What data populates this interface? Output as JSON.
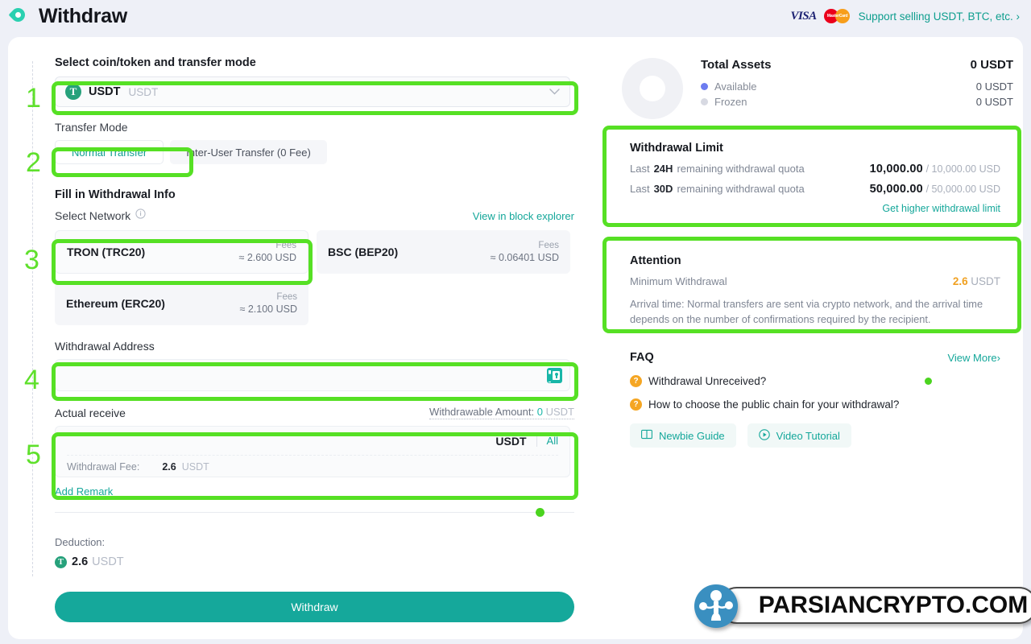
{
  "header": {
    "title": "Withdraw",
    "logo_icon": "app-logo-icon",
    "visa_label": "VISA",
    "mastercard_label": "MasterCard",
    "support_link": "Support selling USDT, BTC, etc.",
    "support_chevron": "›"
  },
  "left": {
    "step1": {
      "number": "1",
      "title": "Select coin/token and transfer mode",
      "coin": {
        "symbol_icon": "T",
        "name": "USDT",
        "sub": "USDT",
        "chevron": "⌄"
      },
      "transfer_mode_label": "Transfer Mode",
      "modes": [
        {
          "label": "Normal Transfer",
          "active": true
        },
        {
          "label": "Inter-User Transfer (0 Fee)",
          "active": false
        }
      ]
    },
    "step2": {
      "number": "2",
      "title": "Fill in Withdrawal Info",
      "select_network_label": "Select Network",
      "info_icon": "info-icon",
      "block_explorer_link": "View in block explorer",
      "networks": [
        {
          "name": "TRON (TRC20)",
          "fees_label": "Fees",
          "fee_value": "≈ 2.600 USD",
          "selected": true
        },
        {
          "name": "BSC (BEP20)",
          "fees_label": "Fees",
          "fee_value": "≈ 0.06401 USD",
          "selected": false
        },
        {
          "name": "Ethereum (ERC20)",
          "fees_label": "Fees",
          "fee_value": "≈ 2.100 USD",
          "selected": false
        }
      ],
      "address_label": "Withdrawal Address",
      "address_value": "",
      "address_placeholder": "",
      "address_book_icon": "address-book-icon",
      "actual_receive_label": "Actual receive",
      "withdrawable_prefix": "Withdrawable Amount:",
      "withdrawable_amount": "0",
      "withdrawable_unit": "USDT",
      "amount_value": "",
      "amount_unit": "USDT",
      "all_label": "All",
      "fee_label": "Withdrawal Fee:",
      "fee_value": "2.6",
      "fee_unit": "USDT",
      "add_remark_label": "Add Remark"
    },
    "deduction_label": "Deduction:",
    "deduction_icon": "T",
    "deduction_value": "2.6",
    "deduction_unit": "USDT",
    "withdraw_button": "Withdraw"
  },
  "right": {
    "assets": {
      "title": "Total Assets",
      "total": "0 USDT",
      "rows": [
        {
          "label": "Available",
          "value": "0 USDT",
          "color": "#6c7cf0"
        },
        {
          "label": "Frozen",
          "value": "0 USDT",
          "color": "#d7d9e2"
        }
      ]
    },
    "limit": {
      "title": "Withdrawal Limit",
      "rows": [
        {
          "prefix": "Last",
          "period": "24H",
          "text": "remaining withdrawal quota",
          "remaining": "10,000.00",
          "total": "/ 10,000.00 USD"
        },
        {
          "prefix": "Last",
          "period": "30D",
          "text": "remaining withdrawal quota",
          "remaining": "50,000.00",
          "total": "/ 50,000.00 USD"
        }
      ],
      "link": "Get higher withdrawal limit"
    },
    "attention": {
      "title": "Attention",
      "min_label": "Minimum Withdrawal",
      "min_value": "2.6",
      "min_unit": "USDT",
      "note": "Arrival time: Normal transfers are sent via crypto network, and the arrival time depends on the number of confirmations required by the recipient."
    },
    "faq": {
      "title": "FAQ",
      "more": "View More›",
      "items": [
        {
          "text": "Withdrawal Unreceived?",
          "icon": "question-icon"
        },
        {
          "text": "How to choose the public chain for your withdrawal?",
          "icon": "question-icon"
        }
      ],
      "guides": [
        {
          "label": "Newbie Guide",
          "icon": "book-icon"
        },
        {
          "label": "Video Tutorial",
          "icon": "play-circle-icon"
        }
      ]
    }
  },
  "annotations": {
    "steps": [
      "1",
      "2",
      "3",
      "4",
      "5"
    ],
    "highlight_color": "#56e024"
  },
  "watermark": {
    "text": "PARSIANCRYPTO.COM",
    "logo_icon": "parsiancrypto-logo-icon"
  }
}
